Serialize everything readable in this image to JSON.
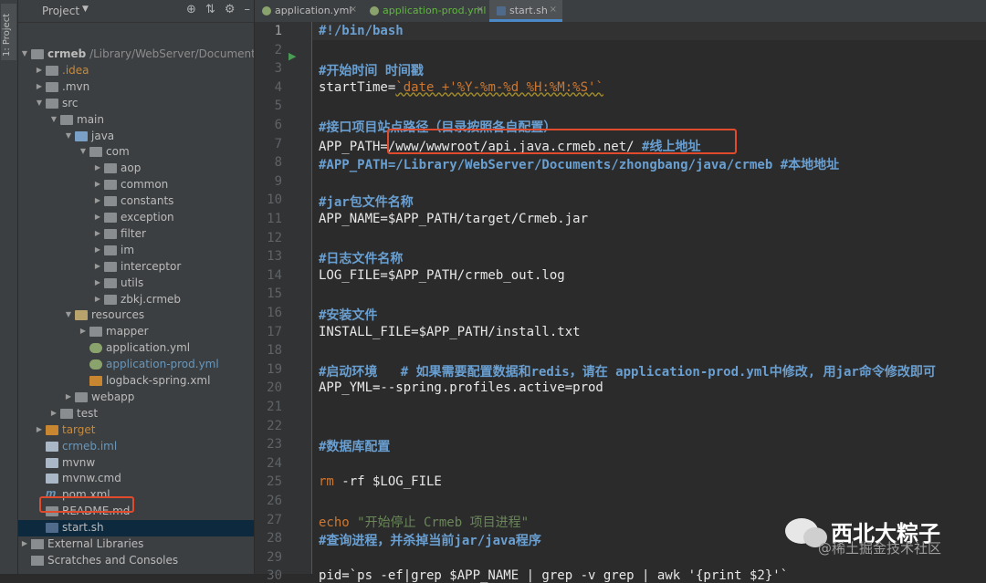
{
  "left_strip": {
    "label": "1: Project"
  },
  "project_panel": {
    "title": "Project",
    "header_icons": [
      "crosshair-icon",
      "collapse-icon",
      "gear-icon",
      "hide-icon"
    ],
    "tree": [
      {
        "depth": 0,
        "arrow": "down",
        "icon": "folder",
        "label": "crmeb",
        "extra": "/Library/WebServer/Documents/z",
        "bold": true
      },
      {
        "depth": 1,
        "arrow": "right",
        "icon": "folder",
        "label": ".idea",
        "color": "orange"
      },
      {
        "depth": 1,
        "arrow": "right",
        "icon": "folder",
        "label": ".mvn"
      },
      {
        "depth": 1,
        "arrow": "down",
        "icon": "folder",
        "label": "src"
      },
      {
        "depth": 2,
        "arrow": "down",
        "icon": "folder",
        "label": "main"
      },
      {
        "depth": 3,
        "arrow": "down",
        "icon": "folder-src",
        "label": "java"
      },
      {
        "depth": 4,
        "arrow": "down",
        "icon": "folder",
        "label": "com"
      },
      {
        "depth": 5,
        "arrow": "right",
        "icon": "folder",
        "label": "aop"
      },
      {
        "depth": 5,
        "arrow": "right",
        "icon": "folder",
        "label": "common"
      },
      {
        "depth": 5,
        "arrow": "right",
        "icon": "folder",
        "label": "constants"
      },
      {
        "depth": 5,
        "arrow": "right",
        "icon": "folder",
        "label": "exception"
      },
      {
        "depth": 5,
        "arrow": "right",
        "icon": "folder",
        "label": "filter"
      },
      {
        "depth": 5,
        "arrow": "right",
        "icon": "folder",
        "label": "im"
      },
      {
        "depth": 5,
        "arrow": "right",
        "icon": "folder",
        "label": "interceptor"
      },
      {
        "depth": 5,
        "arrow": "right",
        "icon": "folder",
        "label": "utils"
      },
      {
        "depth": 5,
        "arrow": "right",
        "icon": "folder",
        "label": "zbkj.crmeb"
      },
      {
        "depth": 3,
        "arrow": "down",
        "icon": "folder-res",
        "label": "resources"
      },
      {
        "depth": 4,
        "arrow": "right",
        "icon": "folder",
        "label": "mapper"
      },
      {
        "depth": 4,
        "arrow": "none",
        "icon": "yml",
        "label": "application.yml"
      },
      {
        "depth": 4,
        "arrow": "none",
        "icon": "yml",
        "label": "application-prod.yml",
        "color": "blueish"
      },
      {
        "depth": 4,
        "arrow": "none",
        "icon": "xml",
        "label": "logback-spring.xml"
      },
      {
        "depth": 3,
        "arrow": "right",
        "icon": "folder",
        "label": "webapp"
      },
      {
        "depth": 2,
        "arrow": "right",
        "icon": "folder-test",
        "label": "test"
      },
      {
        "depth": 1,
        "arrow": "right",
        "icon": "folder-tgt",
        "label": "target",
        "color": "orange"
      },
      {
        "depth": 1,
        "arrow": "none",
        "icon": "file",
        "label": "crmeb.iml",
        "color": "blueish"
      },
      {
        "depth": 1,
        "arrow": "none",
        "icon": "file",
        "label": "mvnw"
      },
      {
        "depth": 1,
        "arrow": "none",
        "icon": "file",
        "label": "mvnw.cmd"
      },
      {
        "depth": 1,
        "arrow": "none",
        "icon": "m",
        "label": "pom.xml"
      },
      {
        "depth": 1,
        "arrow": "none",
        "icon": "md",
        "label": "README.md"
      },
      {
        "depth": 1,
        "arrow": "none",
        "icon": "sh",
        "label": "start.sh",
        "selected": true
      },
      {
        "depth": 0,
        "arrow": "right",
        "icon": "lib",
        "label": "External Libraries"
      },
      {
        "depth": 0,
        "arrow": "none",
        "icon": "lib",
        "label": "Scratches and Consoles"
      }
    ]
  },
  "tabs": [
    {
      "label": "application.yml",
      "icon": "yml-icon",
      "active": false
    },
    {
      "label": "application-prod.yml",
      "icon": "yml-icon",
      "active": false,
      "color": "#62b543"
    },
    {
      "label": "start.sh",
      "icon": "shell-icon",
      "active": true
    }
  ],
  "code": {
    "lines": [
      [
        [
          "#!/bin/bash",
          "cm"
        ]
      ],
      [],
      [
        [
          "#开始时间 时间戳",
          "cm"
        ]
      ],
      [
        [
          "startTime=",
          ""
        ],
        [
          "`date +'%Y-%m-%d %H:%M:%S'`",
          "cmd"
        ]
      ],
      [],
      [
        [
          "#接口项目站点路径（目录按照各自配置）",
          "cm"
        ]
      ],
      [
        [
          "APP_PATH=/www/wwwroot/api.java.crmeb.net/ ",
          ""
        ],
        [
          "#线上地址",
          "cm"
        ]
      ],
      [
        [
          "#APP_PATH=/Library/WebServer/Documents/zhongbang/java/crmeb #本地地址",
          "cm"
        ]
      ],
      [],
      [
        [
          "#jar包文件名称",
          "cm"
        ]
      ],
      [
        [
          "APP_NAME=$APP_PATH/target/Crmeb.jar",
          ""
        ]
      ],
      [],
      [
        [
          "#日志文件名称",
          "cm"
        ]
      ],
      [
        [
          "LOG_FILE=$APP_PATH/crmeb_out.log",
          ""
        ]
      ],
      [],
      [
        [
          "#安装文件",
          "cm"
        ]
      ],
      [
        [
          "INSTALL_FILE=$APP_PATH/install.txt",
          ""
        ]
      ],
      [],
      [
        [
          "#启动环境   # 如果需要配置数据和redis，请在 application-prod.yml中修改, 用jar命令修改即可",
          "cm"
        ]
      ],
      [
        [
          "APP_YML=--spring.profiles.active=prod",
          ""
        ]
      ],
      [],
      [],
      [
        [
          "#数据库配置",
          "cm"
        ]
      ],
      [],
      [
        [
          "rm",
          "kw"
        ],
        [
          " -rf $LOG_FILE",
          ""
        ]
      ],
      [],
      [
        [
          "echo",
          "kw"
        ],
        [
          " \"开始停止 Crmeb 项目进程\"",
          "str"
        ]
      ],
      [
        [
          "#查询进程，并杀掉当前jar/java程序",
          "cm"
        ]
      ],
      [],
      [
        [
          "pid=`ps -ef|grep $APP_NAME | grep -v grep | awk '{print $2}'`",
          ""
        ]
      ]
    ]
  },
  "watermark": {
    "name": "西北大粽子",
    "sub": "@稀土掘金技术社区"
  }
}
